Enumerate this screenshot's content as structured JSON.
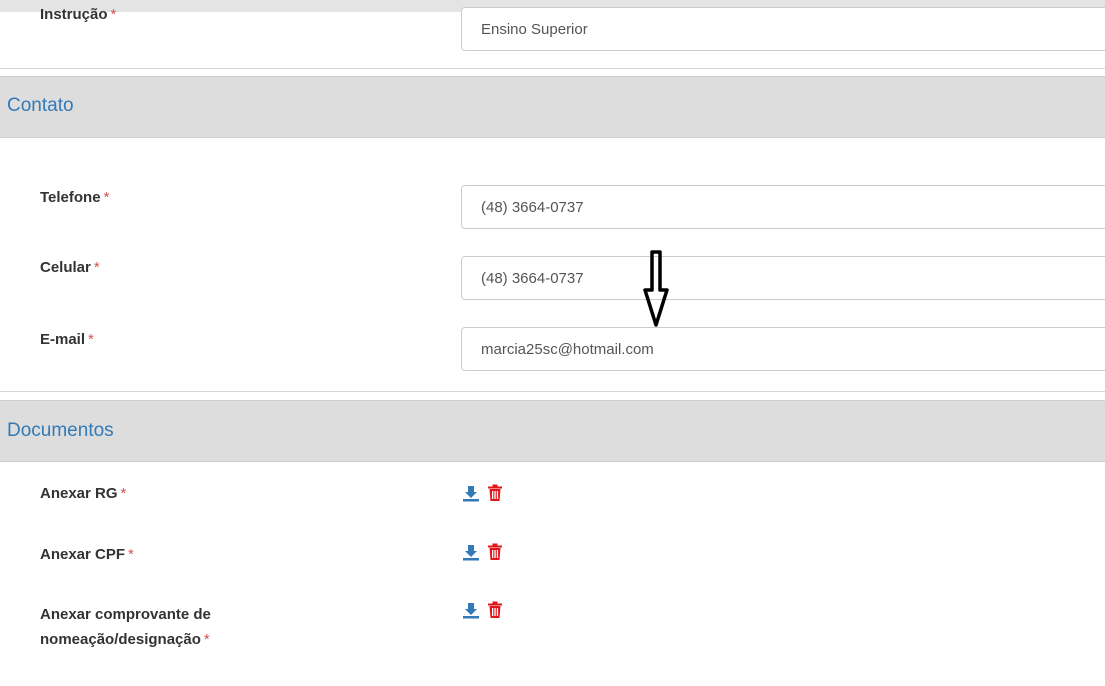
{
  "form": {
    "instrucao": {
      "label": "Instrução",
      "required": "*",
      "value": "Ensino Superior"
    },
    "contato": {
      "title": "Contato",
      "telefone": {
        "label": "Telefone",
        "required": "*",
        "value": "(48) 3664-0737"
      },
      "celular": {
        "label": "Celular",
        "required": "*",
        "value": "(48) 3664-0737"
      },
      "email": {
        "label": "E-mail",
        "required": "*",
        "value": "marcia25sc@hotmail.com"
      }
    },
    "documentos": {
      "title": "Documentos",
      "items": [
        {
          "label": "Anexar RG",
          "required": "*"
        },
        {
          "label": "Anexar CPF",
          "required": "*"
        },
        {
          "label_line1": "Anexar comprovante de",
          "label_line2": "nomeação/designação",
          "required": "*"
        }
      ]
    }
  },
  "icons": {
    "download": "download-icon",
    "delete": "trash-icon"
  },
  "colors": {
    "accent": "#337ab7",
    "danger": "#e0161b",
    "section_bg": "#dddddd",
    "required": "#d9534f"
  }
}
